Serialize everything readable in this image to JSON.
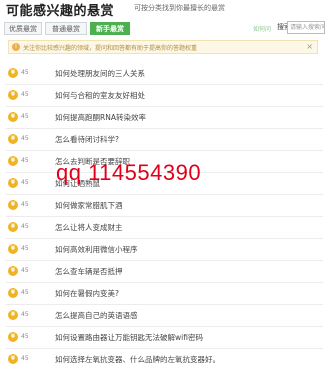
{
  "header": {
    "title": "可能感兴趣的悬赏",
    "subtitle": "可按分类找到你最擅长的悬赏"
  },
  "tabs": [
    {
      "label": "优质悬赏",
      "active": false
    },
    {
      "label": "普通悬赏",
      "active": false
    },
    {
      "label": "新手悬赏",
      "active": true
    }
  ],
  "toolbar": {
    "hint_link": "如何问",
    "search_label": "搜索全",
    "search_placeholder": "请输入搜索问"
  },
  "notice": {
    "text": "关注你比较感兴趣的领域，提问和回答都有助于提高你的答题权重"
  },
  "questions": [
    {
      "count": "45",
      "title": "如何处理朋友间的三人关系"
    },
    {
      "count": "45",
      "title": "如何与合租的室友友好相处"
    },
    {
      "count": "45",
      "title": "如何提高跑酮RNA转染效率"
    },
    {
      "count": "45",
      "title": "怎么看待闭讨科学?"
    },
    {
      "count": "45",
      "title": "怎么去判断是否要辞职"
    },
    {
      "count": "45",
      "title": "如何让晒熟鼠"
    },
    {
      "count": "45",
      "title": "如何做家常腊肌下酒"
    },
    {
      "count": "45",
      "title": "怎么让将人变成财主"
    },
    {
      "count": "45",
      "title": "如何高效利用微信小程序"
    },
    {
      "count": "45",
      "title": "怎么查车辆是否抵押"
    },
    {
      "count": "45",
      "title": "如何在暑假内变美?"
    },
    {
      "count": "45",
      "title": "怎么提高自己的英语语感"
    },
    {
      "count": "45",
      "title": "如何设置路由器让万能钥匙无法破解wifi密码"
    },
    {
      "count": "45",
      "title": "如何选择左氧抗变器、什么品牌的左氧抗变器好。"
    }
  ],
  "watermark": "qq 114554390",
  "colors": {
    "tab_active": "#4caf50",
    "badge": "#f0b323",
    "watermark": "#e0001b"
  }
}
